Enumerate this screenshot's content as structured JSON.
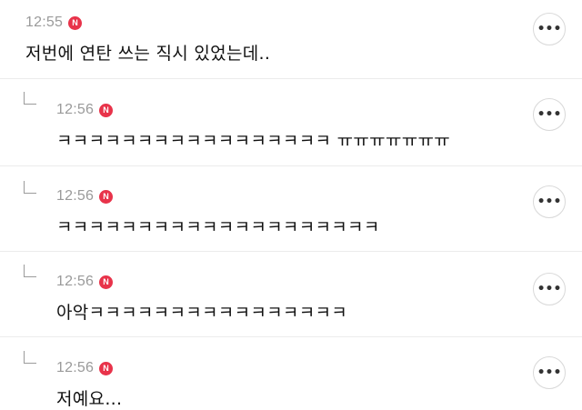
{
  "badge_label": "N",
  "more_label": "•••",
  "comments": [
    {
      "time": "12:55",
      "text": "저번에 연탄 쓰는 직시 있었는데..",
      "is_reply": false
    },
    {
      "time": "12:56",
      "text": "ㅋㅋㅋㅋㅋㅋㅋㅋㅋㅋㅋㅋㅋㅋㅋㅋㅋ ㅠㅠㅠㅠㅠㅠㅠ",
      "is_reply": true
    },
    {
      "time": "12:56",
      "text": "ㅋㅋㅋㅋㅋㅋㅋㅋㅋㅋㅋㅋㅋㅋㅋㅋㅋㅋㅋㅋ",
      "is_reply": true
    },
    {
      "time": "12:56",
      "text": "아악ㅋㅋㅋㅋㅋㅋㅋㅋㅋㅋㅋㅋㅋㅋㅋㅋ",
      "is_reply": true
    },
    {
      "time": "12:56",
      "text": "저예요...",
      "is_reply": true
    }
  ],
  "colors": {
    "badge": "#e8334a",
    "timestamp": "#9a9a9a",
    "divider": "#ececec"
  }
}
